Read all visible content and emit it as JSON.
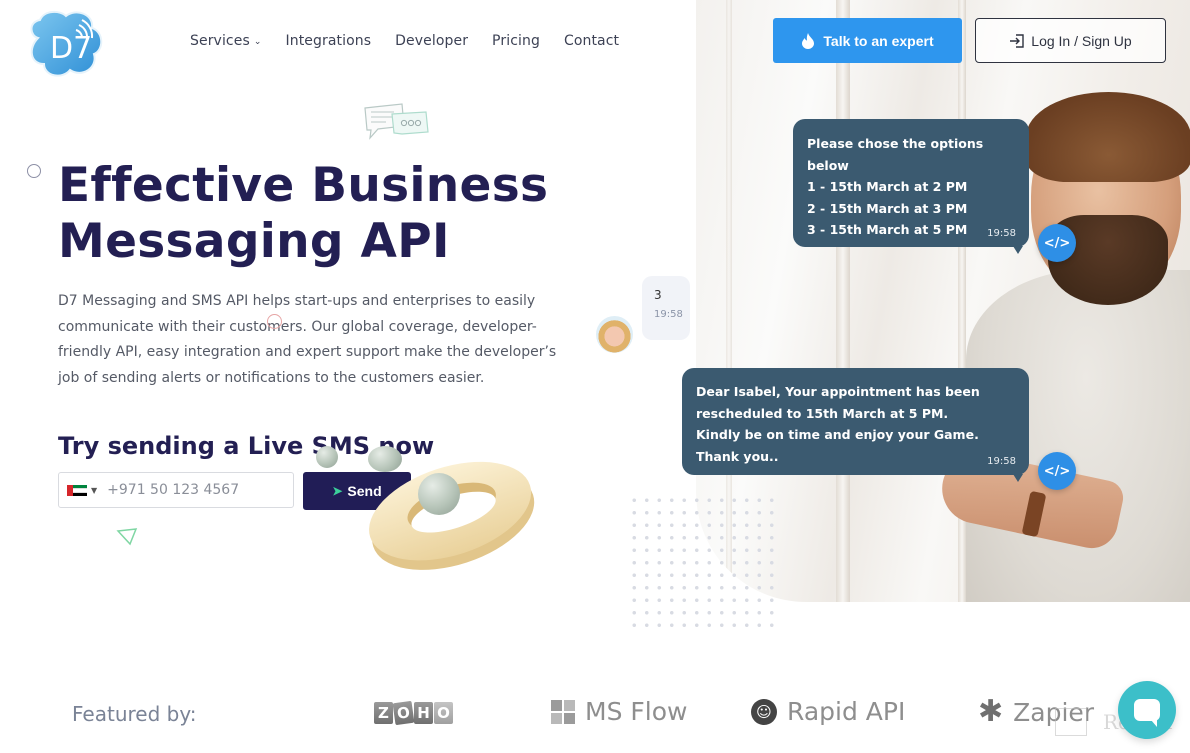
{
  "brand": {
    "logo_text": "D7",
    "logo_color": "#3aa0e0"
  },
  "nav": {
    "items": [
      {
        "label": "Services",
        "has_dropdown": true
      },
      {
        "label": "Integrations"
      },
      {
        "label": "Developer"
      },
      {
        "label": "Pricing"
      },
      {
        "label": "Contact"
      }
    ],
    "dropdown_icon": "chevron-down-icon"
  },
  "header_actions": {
    "expert_label": "Talk to an expert",
    "expert_icon": "fire-icon",
    "expert_color": "#2e96ee",
    "login_label": "Log In / Sign Up",
    "login_icon": "sign-in-icon"
  },
  "hero": {
    "title_line1": "Effective Business",
    "title_line2": "Messaging API",
    "title_color": "#231f53",
    "description": "D7 Messaging and SMS API helps start-ups and enterprises to easily communicate with their customers. Our global coverage, developer-friendly API, easy integration and expert support make the developer’s job of sending alerts or notifications to the customers easier."
  },
  "live_sms": {
    "heading": "Try sending a Live SMS now",
    "country_flag": "UAE",
    "phone_placeholder": "+971 50 123 4567",
    "send_label": "Send",
    "send_icon": "paper-plane-icon",
    "send_color": "#211d56"
  },
  "chat": {
    "bubble_options": {
      "lines": [
        "Please chose the options below",
        "1 - 15th March at 2 PM",
        "2 - 15th March at 3 PM",
        "3 - 15th March at 5 PM"
      ],
      "time": "19:58"
    },
    "reply": {
      "text": "3",
      "time": "19:58"
    },
    "bubble_confirm": {
      "text": "Dear Isabel, Your appointment has been rescheduled to 15th March at 5 PM. Kindly be on time and enjoy your Game. Thank you..",
      "time": "19:58"
    },
    "badge_label": "</>",
    "bubble_color": "#3b5a70"
  },
  "featured": {
    "label": "Featured by:",
    "brands": [
      {
        "name": "ZOHO",
        "letters": [
          "Z",
          "O",
          "H",
          "O"
        ]
      },
      {
        "name": "MS Flow"
      },
      {
        "name": "Rapid API"
      },
      {
        "name": "Zapier"
      }
    ]
  },
  "watermark": {
    "text": "Revain"
  },
  "chat_widget": {
    "icon": "chat-bubble-icon",
    "color": "#3cbfc9"
  }
}
